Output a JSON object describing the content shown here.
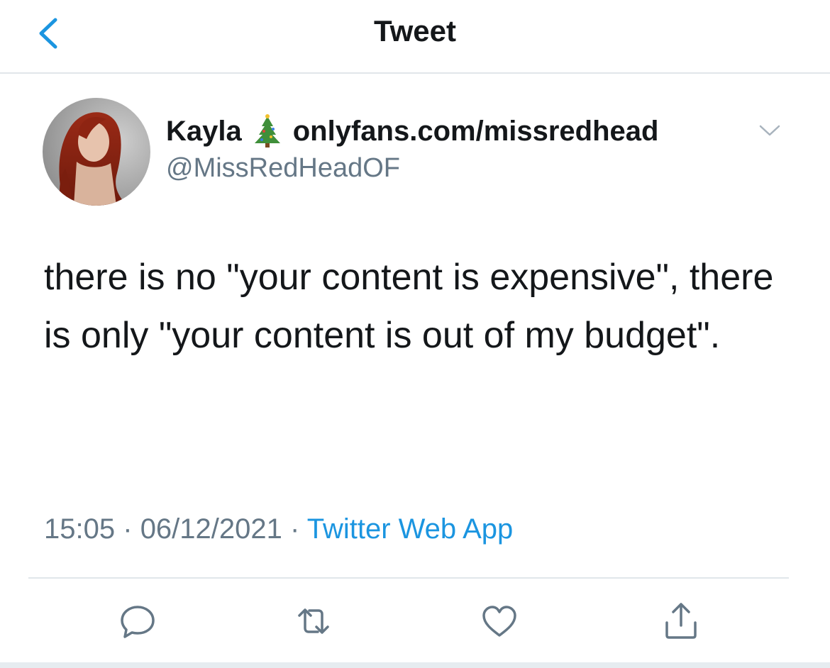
{
  "header": {
    "title": "Tweet",
    "back_icon": "chevron-left-icon"
  },
  "tweet": {
    "author": {
      "display_name": "Kayla",
      "emoji": "christmas-tree-icon",
      "link_in_name": "onlyfans.com/missredhead",
      "handle": "@MissRedHeadOF"
    },
    "text": "there is no \"your content is expensive\", there is only \"your content is out of my budget\".",
    "time": "15:05",
    "separator": "·",
    "date": "06/12/2021",
    "source": "Twitter Web App"
  },
  "actions": [
    "reply-icon",
    "retweet-icon",
    "like-icon",
    "share-icon"
  ],
  "colors": {
    "accent": "#1b95e0",
    "secondary_text": "#657786",
    "divider": "#e1e6ea"
  }
}
